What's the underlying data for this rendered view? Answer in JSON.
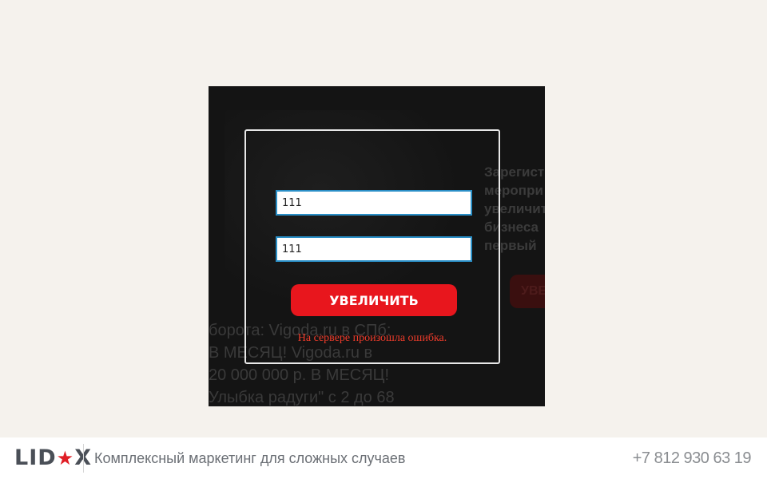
{
  "background": {
    "left_lines": [
      "борота: Vigoda.ru в СПб:",
      "В МЕСЯЦ! Vigoda.ru в",
      "20 000 000 р. В МЕСЯЦ!",
      "Улыбка радуги\" с 2 до 68"
    ],
    "right_lines": [
      "Зарегист",
      "меропри",
      "увеличит",
      "бизнеса",
      "первый"
    ],
    "button_label": "УВЕ"
  },
  "form": {
    "field_1_value": "111",
    "field_2_value": "111",
    "submit_label": "УВЕЛИЧИТЬ",
    "error_message": "На сервере произошла ошибка."
  },
  "footer": {
    "logo_left": "LID",
    "logo_star": "★",
    "logo_right": "X",
    "tagline": "Комплексный маркетинг для сложных случаев",
    "phone": "+7 812 930 63 19"
  },
  "colors": {
    "accent": "#e8161d",
    "error": "#ef3b2a",
    "modal_bg": "#141414",
    "page_bg": "#f5f2ed"
  }
}
